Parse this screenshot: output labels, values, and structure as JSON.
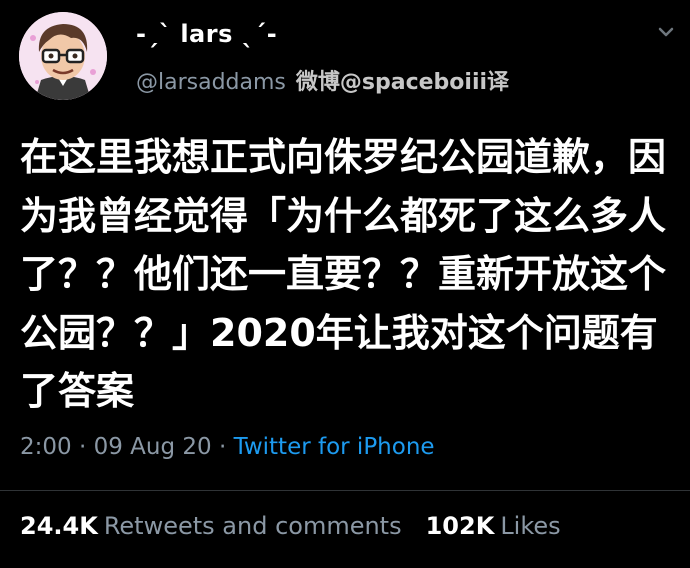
{
  "tweet": {
    "display_name": "-ˏˋ lars ˎˊ-",
    "handle": "@larsaddams",
    "translator_note": "微博@spaceboiii译",
    "text": "在这里我想正式向侏罗纪公园道歉，因为我曾经觉得「为什么都死了这么多人了？？他们还一直要？？重新开放这个公园？？」2020年让我对这个问题有了答案",
    "timestamp": "2:00 · 09 Aug 20 · ",
    "source": "Twitter for iPhone"
  },
  "stats": {
    "retweets_count": "24.4K",
    "retweets_label": "Retweets and comments",
    "likes_count": "102K",
    "likes_label": "Likes"
  },
  "icons": {
    "more": "chevron-down-icon",
    "avatar": "cartoon-avatar"
  },
  "colors": {
    "background": "#000000",
    "secondary_text": "#8b98a5",
    "link": "#1d9bf0"
  }
}
